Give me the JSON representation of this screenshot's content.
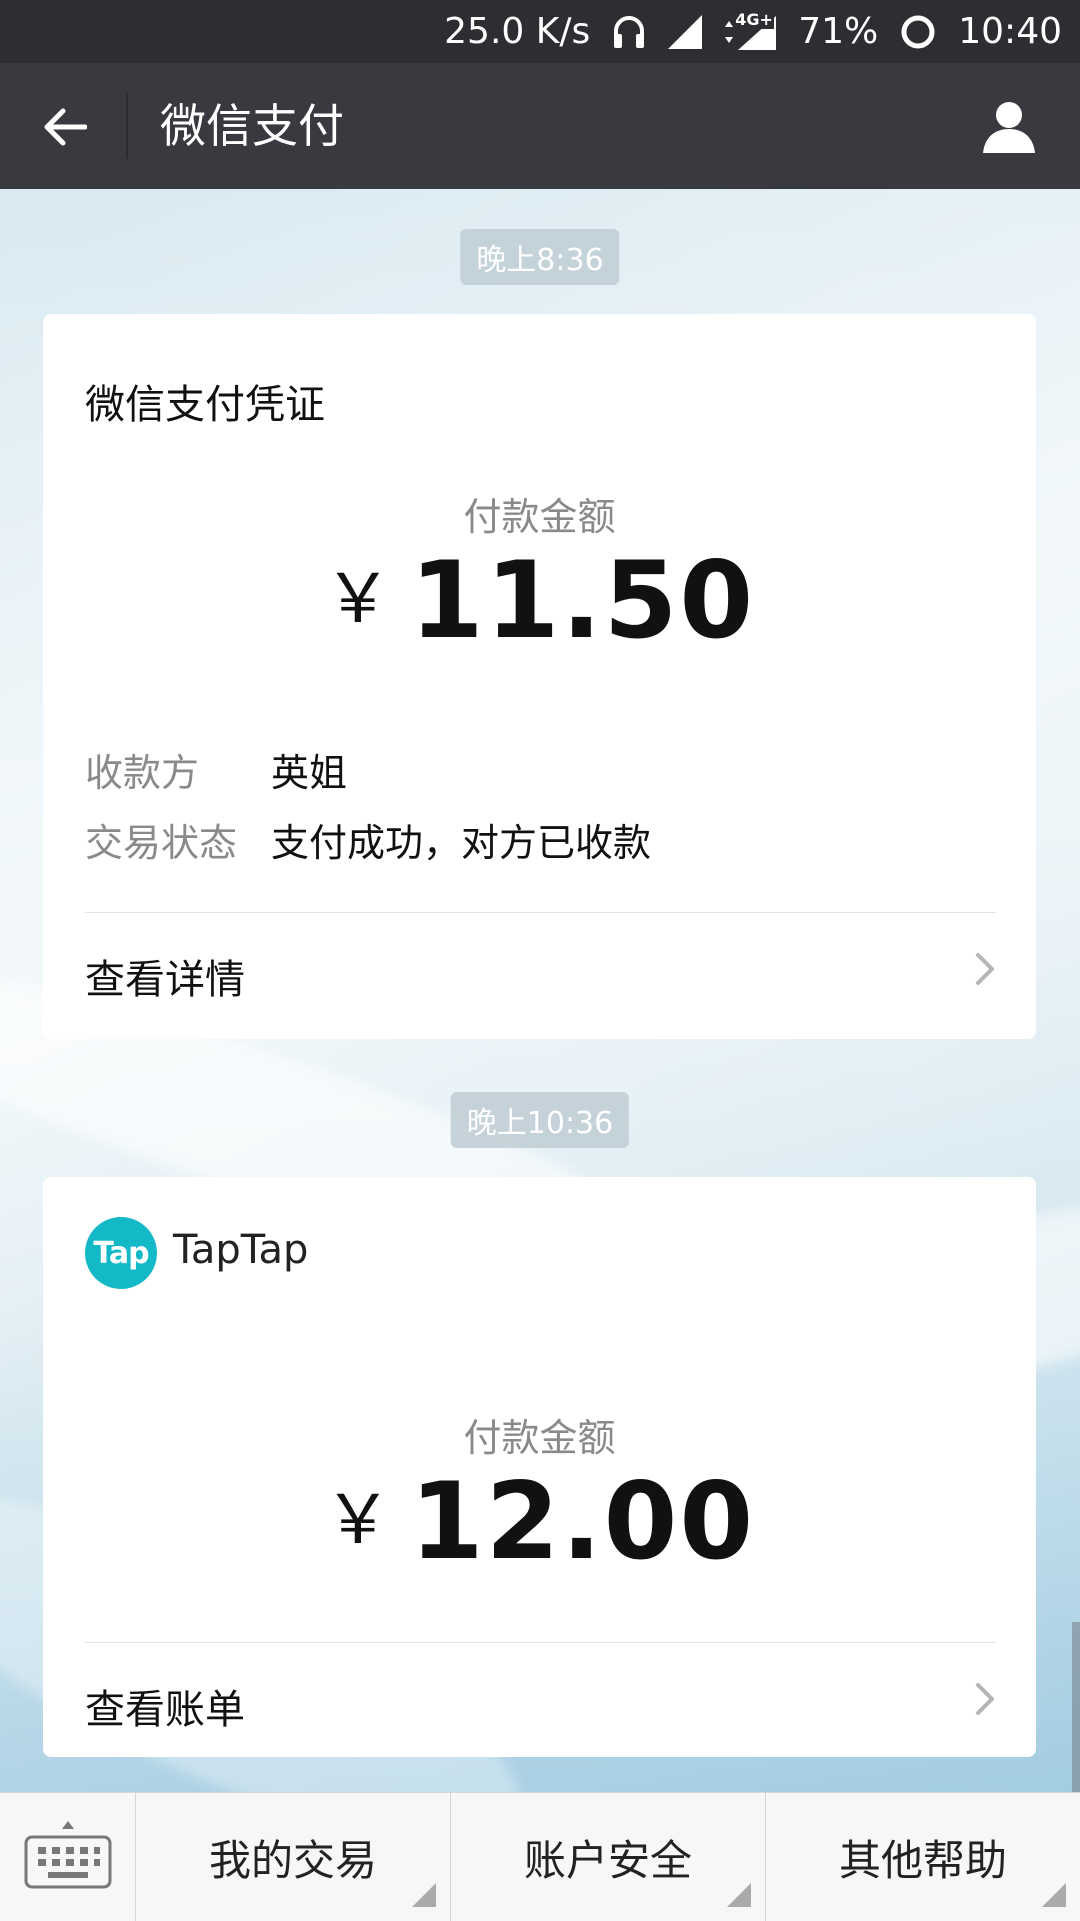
{
  "status_bar": {
    "net_speed": "25.0 K/s",
    "network_type": "4G+",
    "battery": "71%",
    "time": "10:40"
  },
  "header": {
    "title": "微信支付",
    "back_icon": "arrow-left-icon",
    "profile_icon": "person-icon"
  },
  "messages": [
    {
      "time": "晚上8:36",
      "card_title": "微信支付凭证",
      "amount_label": "付款金额",
      "currency": "￥",
      "amount": "11.50",
      "rows": [
        {
          "key": "收款方",
          "value": "英姐"
        },
        {
          "key": "交易状态",
          "value": "支付成功，对方已收款"
        }
      ],
      "link_label": "查看详情"
    },
    {
      "time": "晚上10:36",
      "merchant_logo": "Tap",
      "merchant_name": "TapTap",
      "amount_label": "付款金额",
      "currency": "￥",
      "amount": "12.00",
      "link_label": "查看账单"
    }
  ],
  "bottom_menu": {
    "keyboard_icon": "keyboard-icon",
    "items": [
      "我的交易",
      "账户安全",
      "其他帮助"
    ]
  },
  "colors": {
    "header_bg": "#393a3f",
    "status_bg": "#2d2e31",
    "tap_brand": "#14b9c8"
  }
}
